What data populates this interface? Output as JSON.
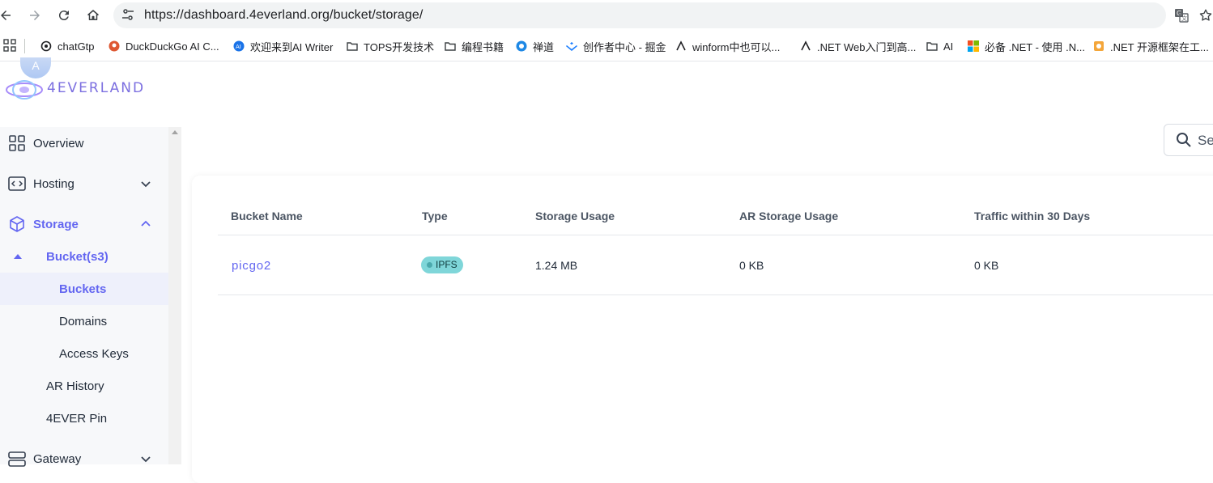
{
  "browser": {
    "url": "https://dashboard.4everland.org/bucket/storage/",
    "bookmarks": [
      {
        "label": "chatGtp",
        "icon": "openai-icon"
      },
      {
        "label": "DuckDuckGo AI C...",
        "icon": "duckduckgo-icon"
      },
      {
        "label": "欢迎来到AI Writer",
        "icon": "ai-writer-icon"
      },
      {
        "label": "TOPS开发技术",
        "icon": "folder-icon"
      },
      {
        "label": "编程书籍",
        "icon": "folder-icon"
      },
      {
        "label": "禅道",
        "icon": "zentao-icon"
      },
      {
        "label": "创作者中心 - 掘金",
        "icon": "juejin-icon"
      },
      {
        "label": "winform中也可以...",
        "icon": "winform-icon"
      },
      {
        "label": ".NET Web入门到高...",
        "icon": "dotnet-icon"
      },
      {
        "label": "AI",
        "icon": "folder-icon"
      },
      {
        "label": "必备 .NET - 使用 .N...",
        "icon": "microsoft-icon"
      },
      {
        "label": ".NET 开源框架在工...",
        "icon": "framework-icon"
      }
    ]
  },
  "app": {
    "logo_text": "4EVERLAND",
    "avatar_text": "A"
  },
  "sidebar": {
    "items": [
      {
        "label": "Overview",
        "icon": "grid-icon"
      },
      {
        "label": "Hosting",
        "icon": "hosting-icon"
      },
      {
        "label": "Storage",
        "icon": "cube-icon"
      },
      {
        "label": "Bucket(s3)"
      },
      {
        "label": "Buckets"
      },
      {
        "label": "Domains"
      },
      {
        "label": "Access Keys"
      },
      {
        "label": "AR History"
      },
      {
        "label": "4EVER Pin"
      },
      {
        "label": "Gateway",
        "icon": "gateway-icon"
      }
    ]
  },
  "search": {
    "placeholder": "Se"
  },
  "table": {
    "headers": [
      "Bucket Name",
      "Type",
      "Storage Usage",
      "AR Storage Usage",
      "Traffic within 30 Days"
    ],
    "rows": [
      {
        "name": "picgo2",
        "type": "IPFS",
        "storage": "1.24 MB",
        "ar_storage": "0 KB",
        "traffic": "0 KB"
      }
    ]
  },
  "colors": {
    "accent": "#6366f1",
    "badge": "#7fd6d9"
  }
}
